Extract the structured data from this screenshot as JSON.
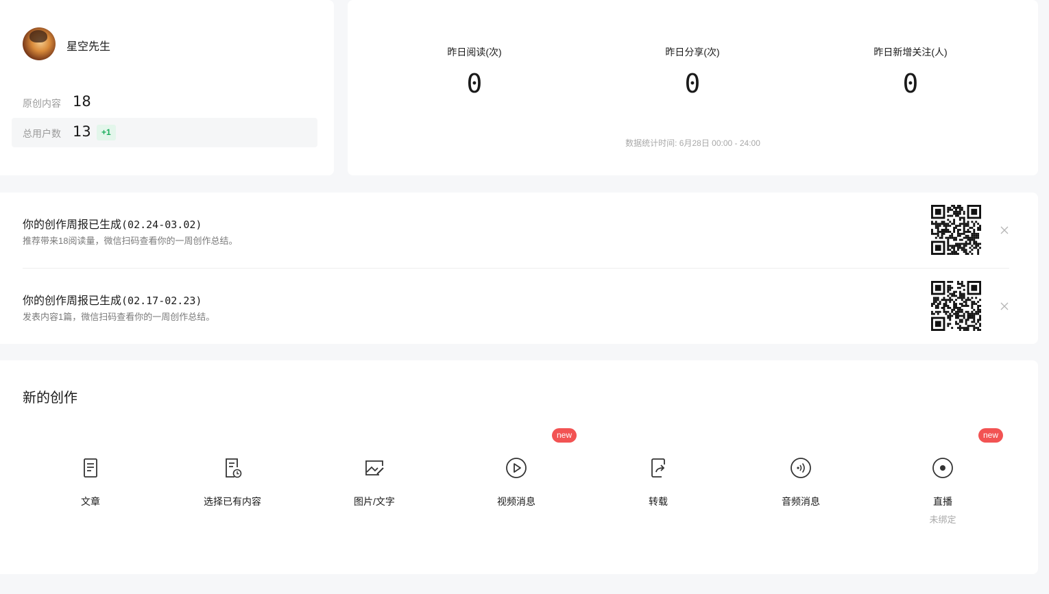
{
  "profile": {
    "username": "星空先生",
    "original_label": "原创内容",
    "original_value": "18",
    "users_label": "总用户数",
    "users_value": "13",
    "users_delta": "+1"
  },
  "stats": {
    "items": [
      {
        "label": "昨日阅读(次)",
        "value": "0"
      },
      {
        "label": "昨日分享(次)",
        "value": "0"
      },
      {
        "label": "昨日新增关注(人)",
        "value": "0"
      }
    ],
    "note": "数据统计时间: 6月28日 00:00 - 24:00"
  },
  "reports": [
    {
      "title_prefix": "你的创作周报已生成",
      "title_range": "(02.24-03.02)",
      "desc": "推荐带来18阅读量，微信扫码查看你的一周创作总结。"
    },
    {
      "title_prefix": "你的创作周报已生成",
      "title_range": "(02.17-02.23)",
      "desc": "发表内容1篇，微信扫码查看你的一周创作总结。"
    }
  ],
  "create": {
    "title": "新的创作",
    "tools": [
      {
        "label": "文章",
        "icon": "article-icon"
      },
      {
        "label": "选择已有内容",
        "icon": "existing-content-icon"
      },
      {
        "label": "图片/文字",
        "icon": "image-text-icon"
      },
      {
        "label": "视频消息",
        "icon": "video-icon",
        "badge": "new"
      },
      {
        "label": "转载",
        "icon": "repost-icon"
      },
      {
        "label": "音频消息",
        "icon": "audio-icon"
      },
      {
        "label": "直播",
        "icon": "live-icon",
        "badge": "new",
        "sub": "未绑定"
      }
    ]
  },
  "colors": {
    "accent_green": "#1aad5c",
    "badge_red": "#f25353",
    "background": "#f6f7f9"
  }
}
